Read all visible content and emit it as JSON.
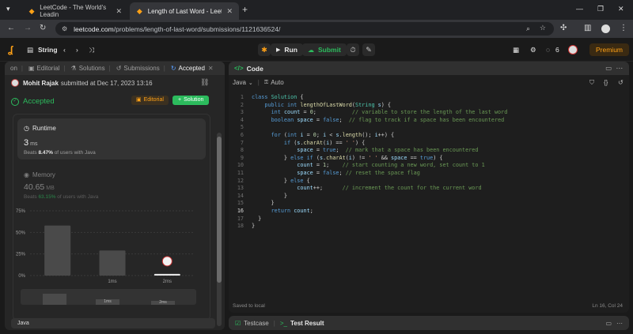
{
  "browser": {
    "tabs": [
      {
        "title": "LeetCode - The World's Leadin",
        "active": false
      },
      {
        "title": "Length of Last Word - LeetCode",
        "active": true
      }
    ],
    "url_host": "leetcode.com",
    "url_path": "/problems/length-of-last-word/submissions/1121636524/"
  },
  "nav": {
    "problem_list": "String",
    "run_label": "Run",
    "submit_label": "Submit",
    "streak": "6",
    "premium_label": "Premium"
  },
  "left": {
    "tabs": [
      {
        "label": "on"
      },
      {
        "label": "Editorial"
      },
      {
        "label": "Solutions"
      },
      {
        "label": "Submissions"
      },
      {
        "label": "Accepted"
      }
    ],
    "author": "Mohit Rajak",
    "submitted_text": "submitted at Dec 17, 2023 13:16",
    "status": "Accepted",
    "editorial_btn": "Editorial",
    "solution_btn": "Solution",
    "runtime": {
      "title": "Runtime",
      "value": "3",
      "unit": "ms",
      "beats_prefix": "Beats",
      "beats_pct": "8.47%",
      "beats_suffix": "of users with Java"
    },
    "memory": {
      "title": "Memory",
      "value": "40.65",
      "unit": "MB",
      "beats_prefix": "Beats",
      "beats_pct": "63.15%",
      "beats_suffix": "of users with Java"
    },
    "language": "Java"
  },
  "chart_data": {
    "type": "bar",
    "categories": [
      "",
      "1ms",
      "2ms"
    ],
    "values": [
      58,
      29,
      2
    ],
    "ylim": [
      0,
      75
    ],
    "yticks": [
      "0%",
      "25%",
      "50%",
      "75%"
    ],
    "bar_color": "#4a4a4a",
    "highlight_color": "#e6e6e6"
  },
  "editor": {
    "title": "Code",
    "language": "Java",
    "mode": "Auto",
    "saved": "Saved to local",
    "cursor": "Ln 16, Col 24"
  },
  "bottom": {
    "testcase": "Testcase",
    "result": "Test Result"
  }
}
